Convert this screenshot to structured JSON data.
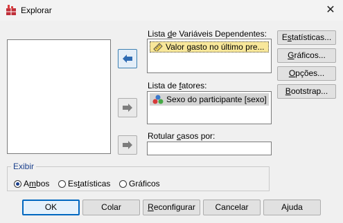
{
  "window": {
    "title": "Explorar",
    "close_label": "✕"
  },
  "dependent_list": {
    "label_pre": "Lista ",
    "label_u": "d",
    "label_post": "e Variáveis Dependentes:",
    "items": [
      {
        "label": "Valor gasto no último pre...",
        "icon": "ruler-scale-icon"
      }
    ]
  },
  "factor_list": {
    "label_pre": "Lista de ",
    "label_u": "f",
    "label_post": "atores:",
    "items": [
      {
        "label": "Sexo do participante [sexo]",
        "icon": "nominal-variable-icon"
      }
    ]
  },
  "label_cases": {
    "label_pre": "Rotular ",
    "label_u": "c",
    "label_post": "asos por:",
    "value": ""
  },
  "side_buttons": [
    {
      "pre": "E",
      "u": "s",
      "post": "tatísticas..."
    },
    {
      "pre": "",
      "u": "G",
      "post": "ráficos..."
    },
    {
      "pre": "",
      "u": "O",
      "post": "pções..."
    },
    {
      "pre": "",
      "u": "B",
      "post": "ootstrap..."
    }
  ],
  "display_group": {
    "title": "Exibir",
    "options": [
      {
        "pre": "A",
        "u": "m",
        "post": "bos",
        "selected": true
      },
      {
        "pre": "Es",
        "u": "t",
        "post": "atísticas",
        "selected": false
      },
      {
        "pre": "Gráficos",
        "u": "",
        "post": "",
        "selected": false
      }
    ]
  },
  "bottom_buttons": [
    {
      "pre": "OK",
      "u": "",
      "post": "",
      "default": true
    },
    {
      "pre": "Colar",
      "u": "",
      "post": "",
      "default": false
    },
    {
      "pre": "",
      "u": "R",
      "post": "econfigurar",
      "default": false
    },
    {
      "pre": "Cancelar",
      "u": "",
      "post": "",
      "default": false
    },
    {
      "pre": "Ajuda",
      "u": "",
      "post": "",
      "default": false
    }
  ],
  "colors": {
    "accent": "#0067c0",
    "arrow_active": "#3c7fb1",
    "selected_item": "#f8e79a"
  }
}
